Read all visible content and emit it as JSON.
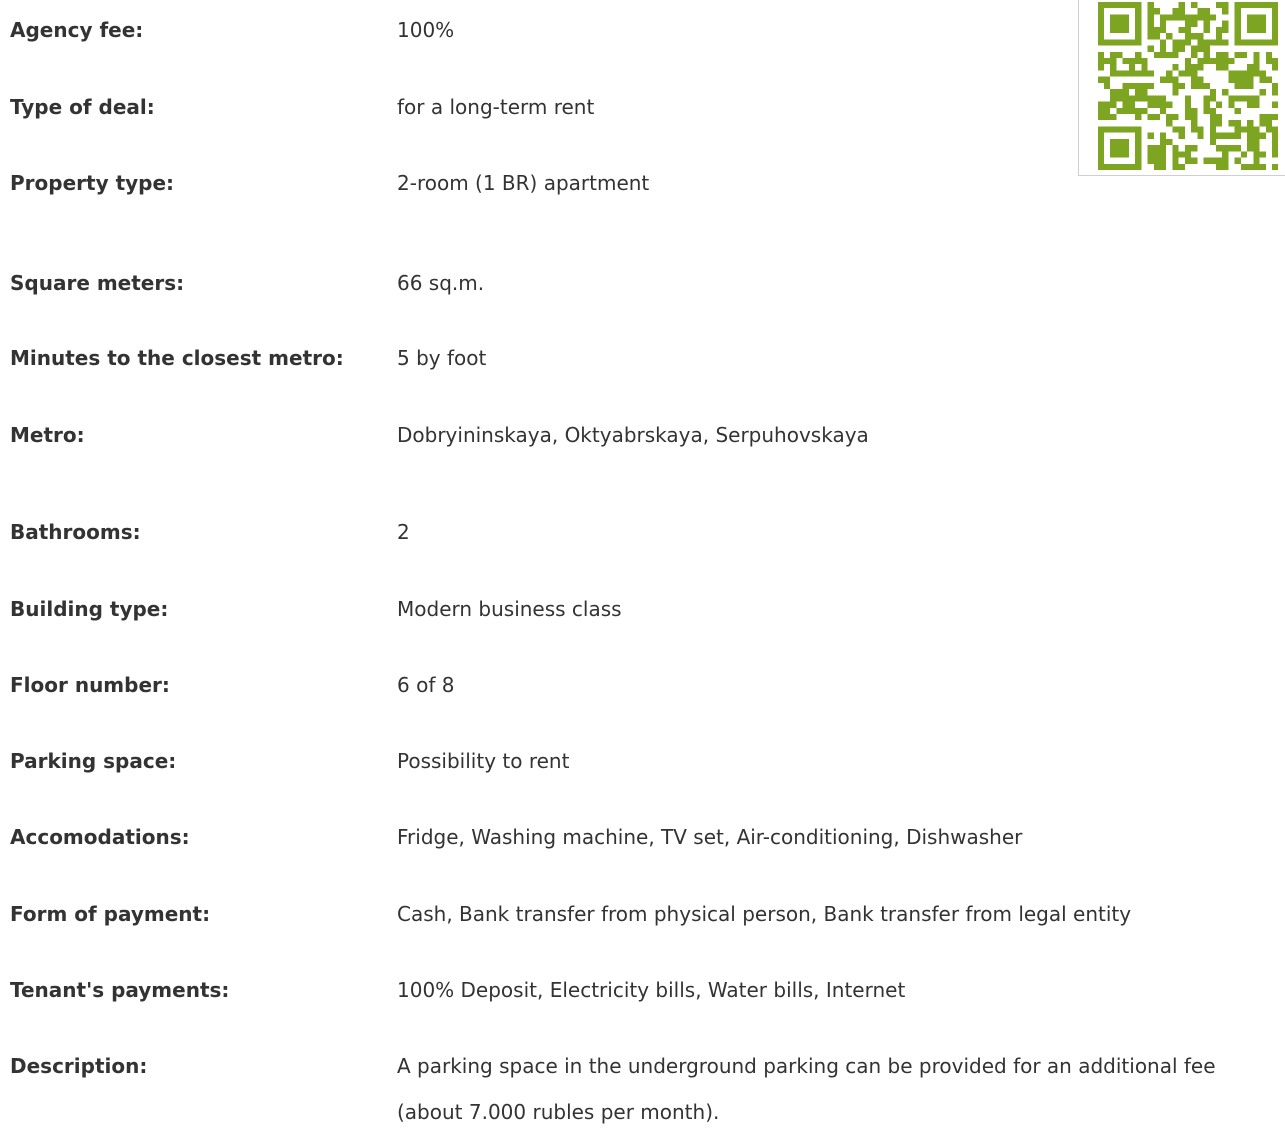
{
  "details": [
    {
      "label": "Agency fee:",
      "value": "100%"
    },
    {
      "label": "Type of deal:",
      "value": "for a long-term rent"
    },
    {
      "label": "Property type:",
      "value": "2-room (1 BR) apartment"
    },
    {
      "label": "Square meters:",
      "value": "66 sq.m."
    },
    {
      "label": "Minutes to the closest metro:",
      "value": "5 by foot"
    },
    {
      "label": "Metro:",
      "value": "Dobryininskaya, Oktyabrskaya, Serpuhovskaya"
    },
    {
      "label": "Bathrooms:",
      "value": "2"
    },
    {
      "label": "Building type:",
      "value": "Modern business class"
    },
    {
      "label": "Floor number:",
      "value": "6 of 8"
    },
    {
      "label": "Parking space:",
      "value": "Possibility to rent"
    },
    {
      "label": "Accomodations:",
      "value": "Fridge, Washing machine, TV set, Air-conditioning, Dishwasher"
    },
    {
      "label": "Form of payment:",
      "value": "Cash, Bank transfer from physical person, Bank transfer from legal entity"
    },
    {
      "label": "Tenant's payments:",
      "value": "100% Deposit, Electricity bills, Water bills, Internet"
    },
    {
      "label": "Description:",
      "value": "A parking space in the underground parking can be provided for an additional fee (about 7.000 rubles per month)."
    }
  ],
  "qr": {
    "icon": "qr-code-icon",
    "color": "#7ea521"
  }
}
